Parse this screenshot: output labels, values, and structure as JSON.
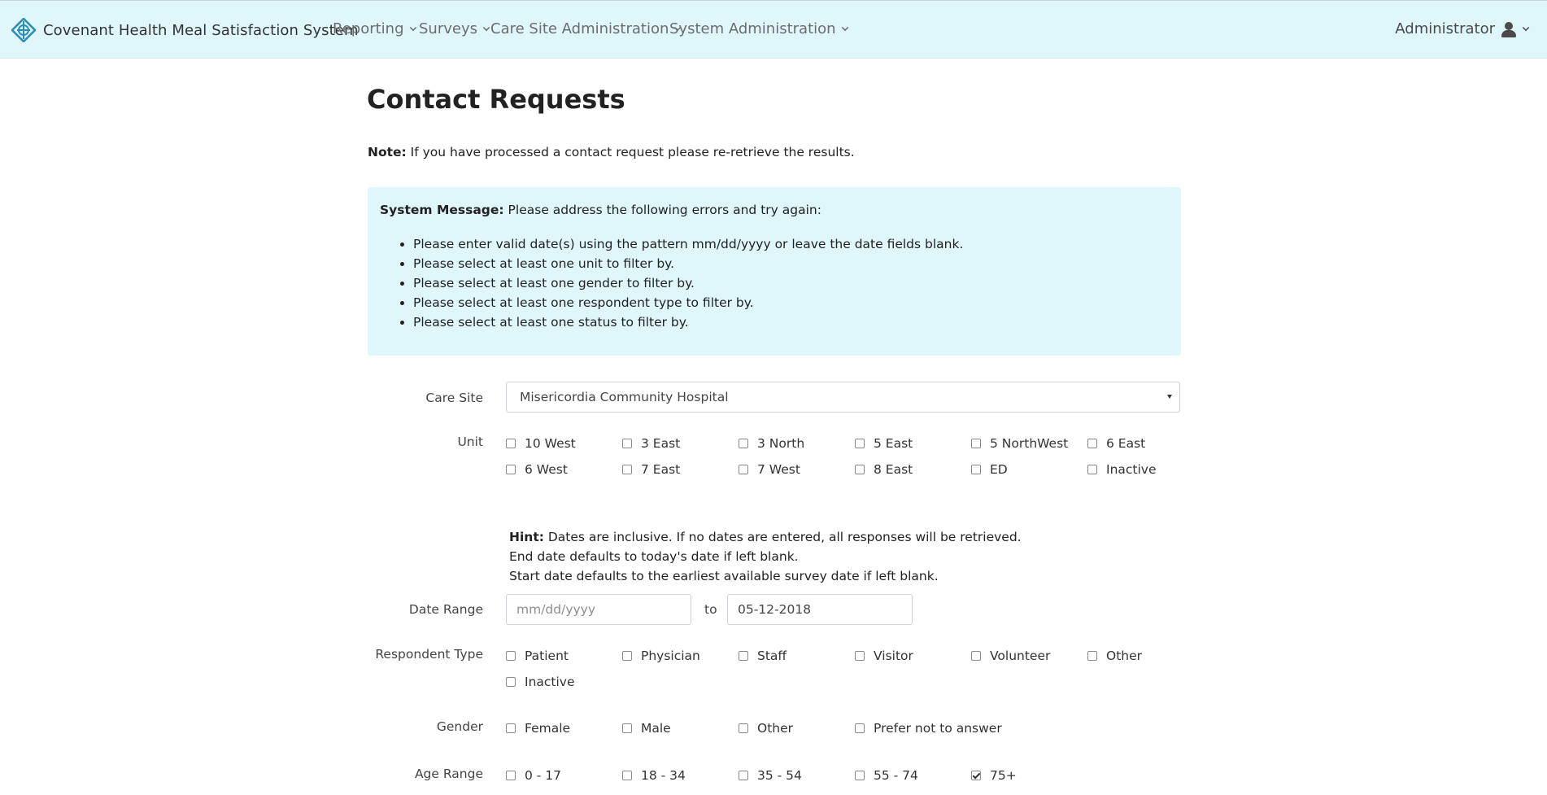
{
  "navbar": {
    "brand": "Covenant Health Meal Satisfaction System",
    "menus": [
      "Reporting",
      "Surveys",
      "Care Site Administration",
      "System Administration"
    ],
    "user": "Administrator"
  },
  "page": {
    "title": "Contact Requests",
    "note_label": "Note:",
    "note_text": " If you have processed a contact request please re-retrieve the results."
  },
  "alert": {
    "label": "System Message:",
    "text": " Please address the following errors and try again:",
    "errors": [
      "Please enter valid date(s) using the pattern mm/dd/yyyy or leave the date fields blank.",
      "Please select at least one unit to filter by.",
      "Please select at least one gender to filter by.",
      "Please select at least one respondent type to filter by.",
      "Please select at least one status to filter by."
    ]
  },
  "form": {
    "care_site_label": "Care Site",
    "care_site_value": "Misericordia Community Hospital",
    "unit_label": "Unit",
    "units": [
      "10 West",
      "3 East",
      "3 North",
      "5 East",
      "5 NorthWest",
      "6 East",
      "6 West",
      "7 East",
      "7 West",
      "8 East",
      "ED",
      "Inactive"
    ],
    "hint_label": "Hint:",
    "hint_line1": " Dates are inclusive. If no dates are entered, all responses will be retrieved.",
    "hint_line2": "End date defaults to today's date if left blank.",
    "hint_line3": "Start date defaults to the earliest available survey date if left blank.",
    "date_range_label": "Date Range",
    "start_date_placeholder": "mm/dd/yyyy",
    "start_date_value": "",
    "to_label": "to",
    "end_date_value": "05-12-2018",
    "respondent_type_label": "Respondent Type",
    "respondent_types": [
      "Patient",
      "Physician",
      "Staff",
      "Visitor",
      "Volunteer",
      "Other",
      "Inactive"
    ],
    "gender_label": "Gender",
    "genders": [
      "Female",
      "Male",
      "Other",
      "Prefer not to answer"
    ],
    "age_range_label": "Age Range",
    "age_ranges": [
      "0 - 17",
      "18 - 34",
      "35 - 54",
      "55 - 74",
      "75+"
    ],
    "age_ranges_checked": [
      false,
      false,
      false,
      false,
      true
    ]
  }
}
